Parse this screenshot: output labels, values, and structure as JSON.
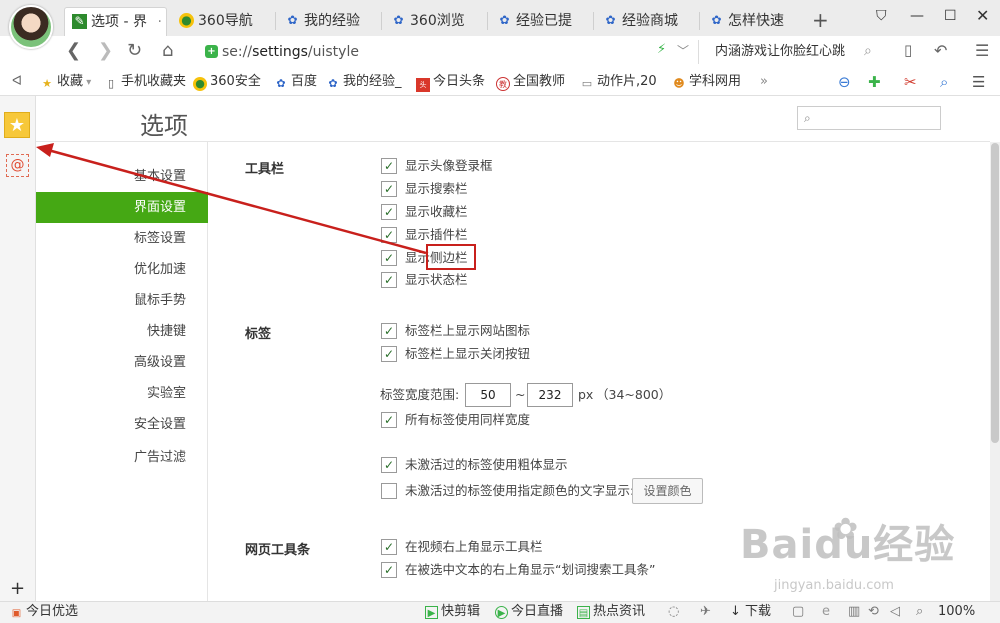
{
  "tabs": [
    {
      "label": "选项 - 界",
      "icon": "wrench-icon",
      "active": true
    },
    {
      "label": "360导航",
      "icon": "360-icon"
    },
    {
      "label": "我的经验",
      "icon": "baidu-paw-icon"
    },
    {
      "label": "360浏览",
      "icon": "baidu-paw-icon"
    },
    {
      "label": "经验已提",
      "icon": "baidu-paw-icon"
    },
    {
      "label": "经验商城",
      "icon": "baidu-paw-icon"
    },
    {
      "label": "怎样快速",
      "icon": "baidu-paw-icon"
    }
  ],
  "address": {
    "prefix": "se://",
    "path": "settings",
    "suffix": "/uistyle"
  },
  "search_box": "内涵游戏让你脸红心跳",
  "bookmarks": [
    {
      "label": "收藏",
      "icon": "star-icon"
    },
    {
      "label": "手机收藏夹",
      "icon": "phone-icon"
    },
    {
      "label": "360安全",
      "icon": "360-icon"
    },
    {
      "label": "百度",
      "icon": "baidu-paw-icon"
    },
    {
      "label": "我的经验_",
      "icon": "baidu-paw-icon"
    },
    {
      "label": "今日头条",
      "icon": "toutiao-icon"
    },
    {
      "label": "全国教师",
      "icon": "teacher-icon"
    },
    {
      "label": "动作片,20",
      "icon": "page-icon"
    },
    {
      "label": "学科网用",
      "icon": "xueke-icon"
    }
  ],
  "page": {
    "title": "选项"
  },
  "nav": [
    "基本设置",
    "界面设置",
    "标签设置",
    "优化加速",
    "鼠标手势",
    "快捷键",
    "高级设置",
    "实验室",
    "安全设置",
    "广告过滤"
  ],
  "nav_selected": "界面设置",
  "toolbar_section": {
    "title": "工具栏",
    "options": [
      {
        "label": "显示头像登录框",
        "checked": true
      },
      {
        "label": "显示搜索栏",
        "checked": true
      },
      {
        "label": "显示收藏栏",
        "checked": true
      },
      {
        "label": "显示插件栏",
        "checked": true
      },
      {
        "label": "显示侧边栏",
        "checked": true
      },
      {
        "label": "显示状态栏",
        "checked": true
      }
    ]
  },
  "tab_section": {
    "title": "标签",
    "options": [
      {
        "label": "标签栏上显示网站图标",
        "checked": true
      },
      {
        "label": "标签栏上显示关闭按钮",
        "checked": true
      }
    ],
    "width_label": "标签宽度范围:",
    "width_min": "50",
    "width_sep": "~",
    "width_max": "232",
    "width_unit": "px",
    "width_hint": "（34~800）",
    "same_width": {
      "label": "所有标签使用同样宽度",
      "checked": true
    },
    "bold": {
      "label": "未激活过的标签使用粗体显示",
      "checked": true
    },
    "color": {
      "label": "未激活过的标签使用指定颜色的文字显示:",
      "checked": false
    },
    "color_button": "设置颜色"
  },
  "webtool_section": {
    "title": "网页工具条",
    "options": [
      {
        "label": "在视频右上角显示工具栏",
        "checked": true
      },
      {
        "label": "在被选中文本的右上角显示“划词搜索工具条”",
        "checked": true
      }
    ]
  },
  "status_bar": {
    "left": "今日优选",
    "items": [
      "快剪辑",
      "今日直播",
      "热点资讯"
    ],
    "download": "下载",
    "zoom": "100%"
  },
  "watermark": {
    "brand": "Baidu经验",
    "url": "jingyan.baidu.com"
  },
  "colors": {
    "accent": "#45a814",
    "highlight": "#c8201c"
  }
}
